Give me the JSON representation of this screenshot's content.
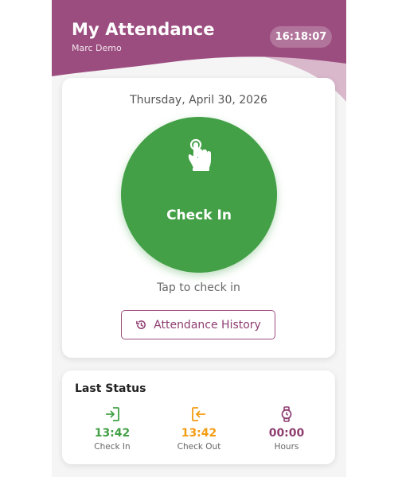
{
  "header": {
    "title": "My Attendance",
    "user_name": "Marc Demo",
    "clock": "16:18:07"
  },
  "main": {
    "date": "Thursday, April 30, 2026",
    "check_in_label": "Check In",
    "tap_hint": "Tap to check in",
    "history_button_label": "Attendance History"
  },
  "last_status": {
    "title": "Last Status",
    "items": [
      {
        "time": "13:42",
        "label": "Check In",
        "icon": "check-in-icon",
        "color": "#43a047"
      },
      {
        "time": "13:42",
        "label": "Check Out",
        "icon": "check-out-icon",
        "color": "#f39c12"
      },
      {
        "time": "00:00",
        "label": "Hours",
        "icon": "watch-icon",
        "color": "#8e3d70"
      }
    ]
  },
  "colors": {
    "brand": "#9c4d7f",
    "brand_light": "#d7b3c8",
    "check_in_green": "#43a047",
    "background": "#f5f5f5"
  }
}
